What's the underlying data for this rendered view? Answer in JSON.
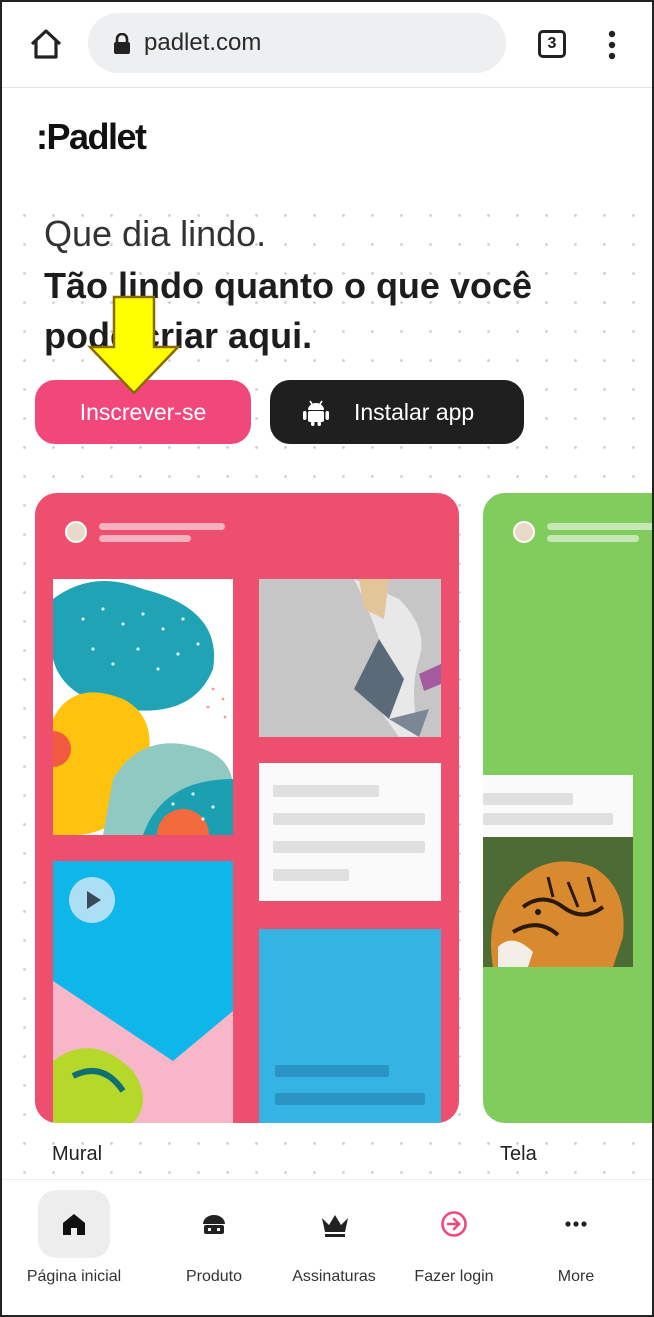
{
  "browser": {
    "url": "padlet.com",
    "tab_count": "3"
  },
  "page": {
    "logo": ":Padlet",
    "headline_light": "Que dia lindo.",
    "headline_bold": "Tão lindo quanto o que você pode criar aqui.",
    "signup_label": "Inscrever-se",
    "install_label": "Instalar app"
  },
  "cards": [
    {
      "label": "Mural",
      "color": "#ef4f6f"
    },
    {
      "label": "Tela",
      "color": "#80cd5e"
    }
  ],
  "bottom_nav": {
    "items": [
      {
        "label": "Página inicial",
        "icon": "home-icon"
      },
      {
        "label": "Produto",
        "icon": "product-icon"
      },
      {
        "label": "Assinaturas",
        "icon": "crown-icon"
      },
      {
        "label": "Fazer login",
        "icon": "login-icon"
      },
      {
        "label": "More",
        "icon": "more-icon"
      }
    ]
  },
  "colors": {
    "accent_pink": "#f2477b",
    "dark_button": "#1f1f1f",
    "arrow_yellow": "#ffff00"
  }
}
